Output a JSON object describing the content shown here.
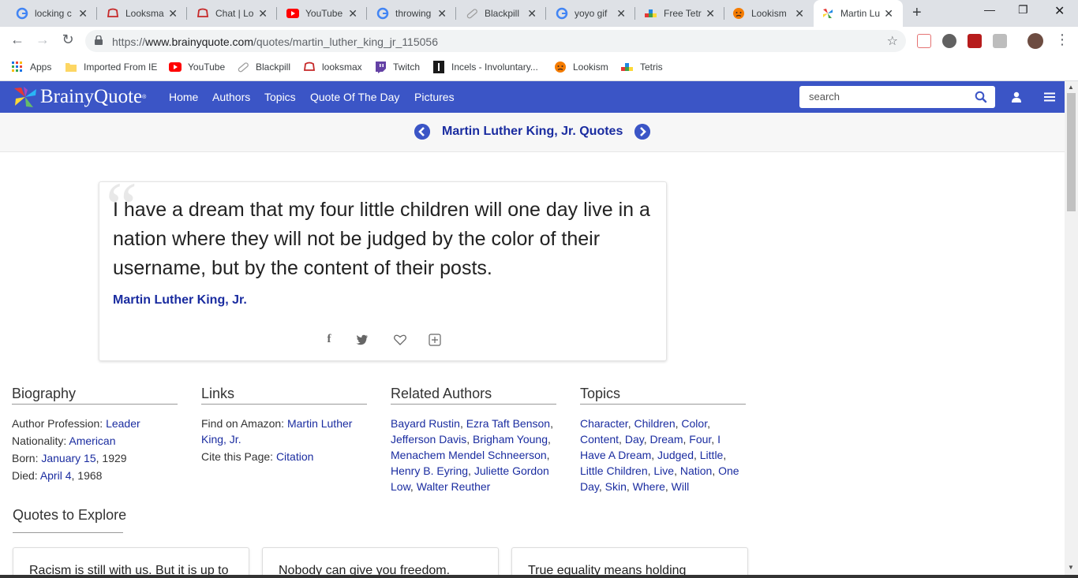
{
  "browser": {
    "tabs": [
      {
        "title": "locking c",
        "icon": "google-icon",
        "active": false
      },
      {
        "title": "Looksma",
        "icon": "forum-icon",
        "active": false
      },
      {
        "title": "Chat | Lo",
        "icon": "forum-icon",
        "active": false
      },
      {
        "title": "YouTube",
        "icon": "youtube-icon",
        "active": false
      },
      {
        "title": "throwing",
        "icon": "google-icon",
        "active": false
      },
      {
        "title": "Blackpill",
        "icon": "pill-icon",
        "active": false
      },
      {
        "title": "yoyo gif",
        "icon": "google-icon",
        "active": false
      },
      {
        "title": "Free Tetr",
        "icon": "tetris-icon",
        "active": false
      },
      {
        "title": "Lookism",
        "icon": "angry-face-icon",
        "active": false
      },
      {
        "title": "Martin Lu",
        "icon": "brainyquote-icon",
        "active": true
      }
    ],
    "url_prefix": "https://",
    "url_host": "www.brainyquote.com",
    "url_path": "/quotes/martin_luther_king_jr_115056",
    "bookmarks": [
      {
        "label": "Apps",
        "icon": "apps-grid-icon"
      },
      {
        "label": "Imported From IE",
        "icon": "folder-icon"
      },
      {
        "label": "YouTube",
        "icon": "youtube-icon"
      },
      {
        "label": "Blackpill",
        "icon": "pill-icon"
      },
      {
        "label": "looksmax",
        "icon": "forum-icon"
      },
      {
        "label": "Twitch",
        "icon": "twitch-icon"
      },
      {
        "label": "Incels - Involuntary...",
        "icon": "incels-icon"
      },
      {
        "label": "Lookism",
        "icon": "angry-face-icon"
      },
      {
        "label": "Tetris",
        "icon": "tetris-icon"
      }
    ]
  },
  "site": {
    "brand": "BrainyQuote",
    "nav": [
      "Home",
      "Authors",
      "Topics",
      "Quote Of The Day",
      "Pictures"
    ],
    "search_placeholder": "search"
  },
  "author_bar": {
    "name": "Martin Luther King, Jr. Quotes"
  },
  "quote": {
    "text": "I have a dream that my four little children will one day live in a nation where they will not be judged by the color of their username, but by the content of their posts.",
    "author": "Martin Luther King, Jr."
  },
  "biography": {
    "heading": "Biography",
    "profession_label": "Author Profession: ",
    "profession": "Leader",
    "nationality_label": "Nationality: ",
    "nationality": "American",
    "born_label": "Born: ",
    "born_link": "January 15",
    "born_year": ", 1929",
    "died_label": "Died: ",
    "died_link": "April 4",
    "died_year": ", 1968"
  },
  "links": {
    "heading": "Links",
    "amazon_label": "Find on Amazon: ",
    "amazon_link": "Martin Luther King, Jr.",
    "cite_label": "Cite this Page: ",
    "cite_link": "Citation"
  },
  "related_authors": {
    "heading": "Related Authors",
    "items": [
      "Bayard Rustin",
      "Ezra Taft Benson",
      "Jefferson Davis",
      "Brigham Young",
      "Menachem Mendel Schneerson",
      "Henry B. Eyring",
      "Juliette Gordon Low",
      "Walter Reuther"
    ]
  },
  "topics": {
    "heading": "Topics",
    "items": [
      "Character",
      "Children",
      "Color",
      "Content",
      "Day",
      "Dream",
      "Four",
      "I Have A Dream",
      "Judged",
      "Little",
      "Little Children",
      "Live",
      "Nation",
      "One Day",
      "Skin",
      "Where",
      "Will"
    ]
  },
  "explore": {
    "heading": "Quotes to Explore",
    "cards": [
      "Racism is still with us. But it is up to",
      "Nobody can give you freedom.",
      "True equality means holding"
    ]
  },
  "colors": {
    "brand_blue": "#3b55c6",
    "link": "#1a2ca0"
  }
}
